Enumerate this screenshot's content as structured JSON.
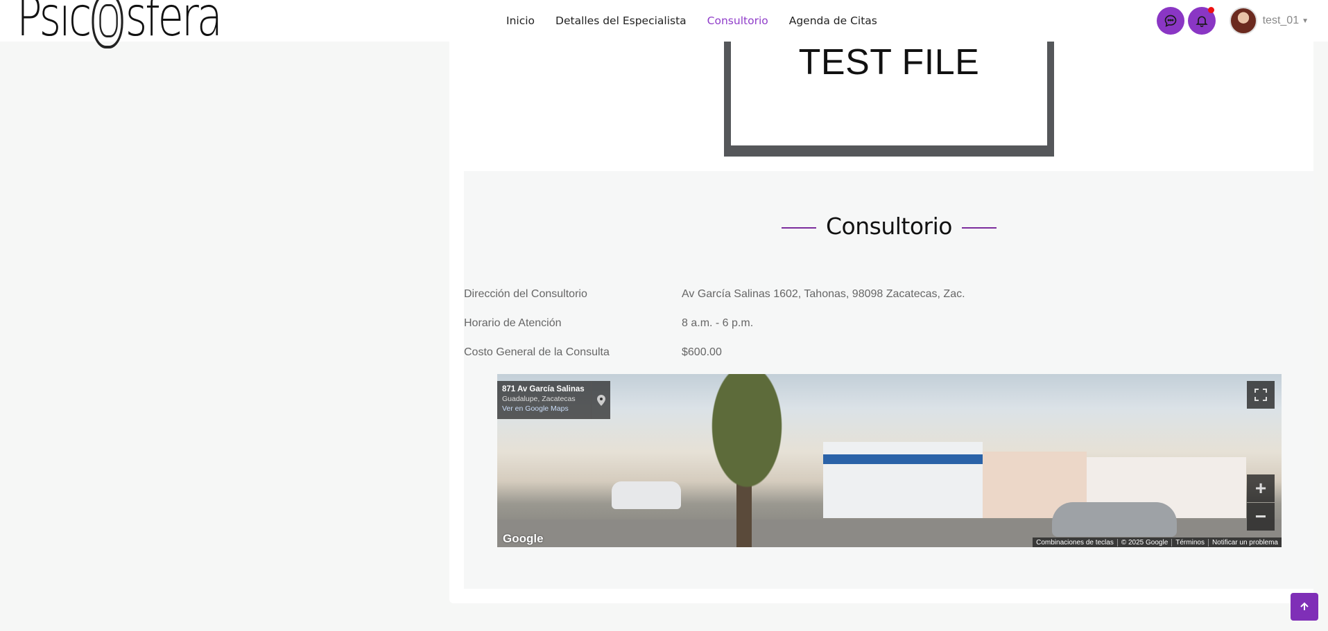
{
  "brand": {
    "logo_text": "Psicosfera"
  },
  "nav": {
    "items": [
      {
        "label": "Inicio",
        "active": false
      },
      {
        "label": "Detalles del Especialista",
        "active": false
      },
      {
        "label": "Consultorio",
        "active": true
      },
      {
        "label": "Agenda de Citas",
        "active": false
      }
    ]
  },
  "header_right": {
    "chat_icon": "chat-icon",
    "bell_icon": "bell-icon",
    "has_notification": true,
    "username": "test_01"
  },
  "document_preview": {
    "text": "TEST FILE"
  },
  "section": {
    "title": "Consultorio",
    "rows": [
      {
        "label": "Dirección del Consultorio",
        "value": "Av García Salinas 1602, Tahonas, 98098 Zacatecas, Zac."
      },
      {
        "label": "Horario de Atención",
        "value": "8 a.m. - 6 p.m."
      },
      {
        "label": "Costo General de la Consulta",
        "value": "$600.00"
      }
    ]
  },
  "street_view": {
    "address": "871 Av García Salinas",
    "city": "Guadalupe, Zacatecas",
    "link": "Ver en Google Maps",
    "google_logo": "Google",
    "attribution": [
      "Combinaciones de teclas",
      "© 2025 Google",
      "Términos",
      "Notificar un problema"
    ]
  },
  "colors": {
    "accent": "#8a36c4",
    "active_nav": "#8f3cc9"
  }
}
